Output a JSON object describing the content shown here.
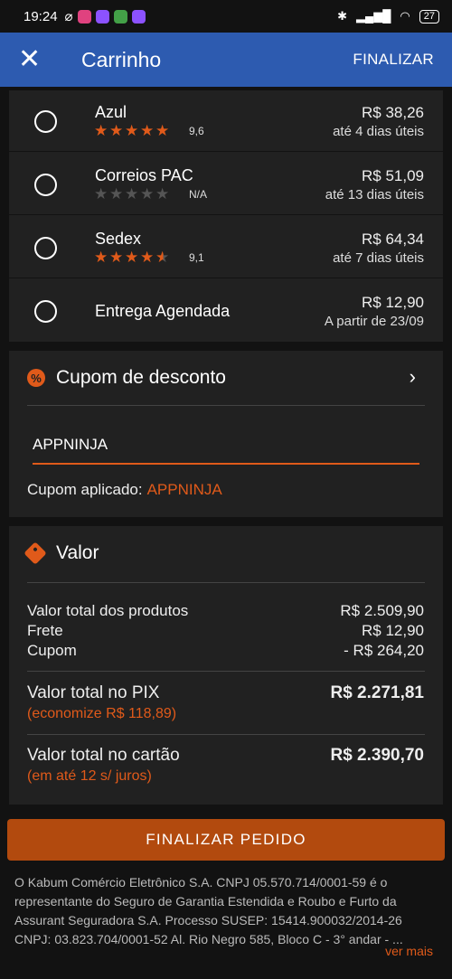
{
  "status_bar": {
    "time": "19:24",
    "battery": "27",
    "notif_icon_colors": [
      "#e0427f",
      "#8c52ff",
      "#43a047",
      "#8c52ff"
    ]
  },
  "app_bar": {
    "title": "Carrinho",
    "close_icon": "close-icon",
    "action_label": "FINALIZAR"
  },
  "shipping": {
    "options": [
      {
        "name": "Azul",
        "stars": 5,
        "rating": "9,6",
        "price": "R$ 38,26",
        "eta": "até 4 dias úteis"
      },
      {
        "name": "Correios PAC",
        "stars": 0,
        "rating": "N/A",
        "price": "R$ 51,09",
        "eta": "até 13 dias úteis"
      },
      {
        "name": "Sedex",
        "stars": 4.5,
        "rating": "9,1",
        "price": "R$ 64,34",
        "eta": "até 7 dias úteis"
      },
      {
        "name": "Entrega Agendada",
        "price": "R$ 12,90",
        "eta": "A partir de 23/09"
      }
    ]
  },
  "coupon": {
    "title": "Cupom de desconto",
    "input_value": "APPNINJA",
    "applied_label": "Cupom aplicado:",
    "applied_code": "APPNINJA"
  },
  "summary": {
    "title": "Valor",
    "products_label": "Valor total dos produtos",
    "products_value": "R$ 2.509,90",
    "shipping_label": "Frete",
    "shipping_value": "R$ 12,90",
    "coupon_label": "Cupom",
    "coupon_value": "- R$ 264,20",
    "pix_label": "Valor total no PIX",
    "pix_value": "R$ 2.271,81",
    "pix_note": "(economize R$ 118,89)",
    "card_label": "Valor total no cartão",
    "card_value": "R$ 2.390,70",
    "card_note": "(em até 12 s/ juros)"
  },
  "finalize_button": "FINALIZAR PEDIDO",
  "legal_text": "O Kabum Comércio Eletrônico S.A. CNPJ 05.570.714/0001-59 é o representante do Seguro de Garantia Estendida e Roubo e Furto da Assurant Seguradora S.A. Processo SUSEP: 15414.900032/2014-26 CNPJ: 03.823.704/0001-52 Al. Rio Negro 585, Bloco C - 3° andar - ...",
  "see_more": "ver mais",
  "accent_color": "#e05a1a",
  "appbar_color": "#2d5bb0"
}
